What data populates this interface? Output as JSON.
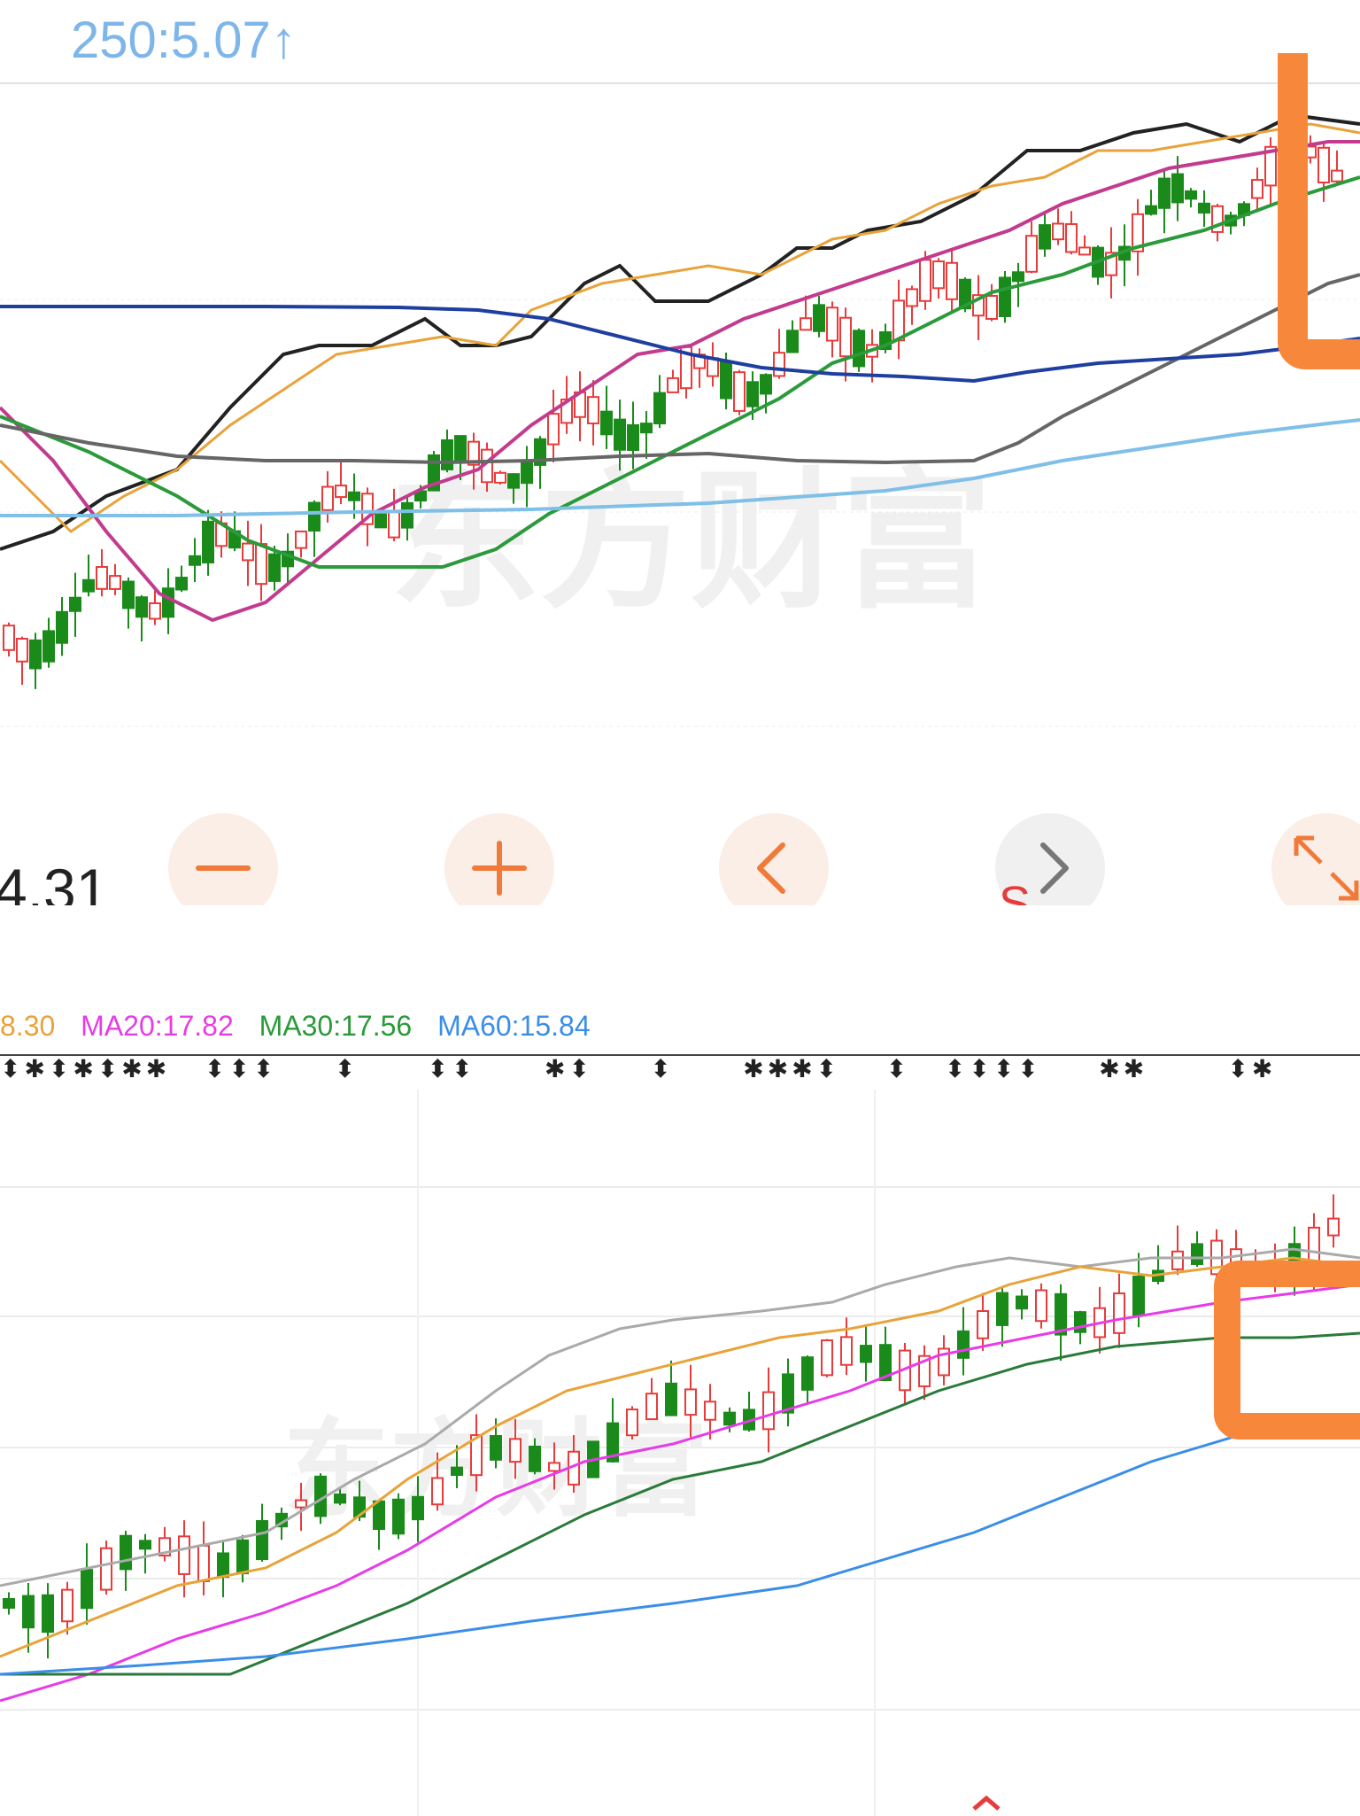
{
  "header": {
    "indicator_text": "250:5.07",
    "arrow": "up-arrow-icon"
  },
  "upper_panel": {
    "left_price": "4.31",
    "watermark": "东方财富"
  },
  "controls": [
    {
      "name": "zoom-out-button",
      "icon": "minus-icon"
    },
    {
      "name": "zoom-in-button",
      "icon": "plus-icon"
    },
    {
      "name": "prev-button",
      "icon": "chevron-left-icon"
    },
    {
      "name": "next-button",
      "icon": "chevron-right-icon"
    },
    {
      "name": "fullscreen-button",
      "icon": "expand-icon"
    }
  ],
  "lower_panel": {
    "ma_labels": [
      {
        "text": "8.30",
        "color": "#e8a33a"
      },
      {
        "text": "MA20:17.82",
        "color": "#e83be8"
      },
      {
        "text": "MA30:17.56",
        "color": "#2a9a3a"
      },
      {
        "text": "MA60:15.84",
        "color": "#3a8ee8"
      }
    ],
    "signal_marks": "⬍✱⬍✱⬍✱✱   ⬍⬍⬍     ⬍      ⬍⬍      ✱⬍     ⬍      ✱✱✱⬍    ⬍   ⬍⬍⬍⬍     ✱✱       ⬍✱",
    "watermark": "东方财富"
  },
  "chart_data": [
    {
      "type": "candlestick",
      "title": "",
      "series": [
        {
          "name": "",
          "color": "#e83b3b",
          "note_label": ""
        }
      ],
      "trend": "rising",
      "overlay_lines": [
        {
          "color": "#222222"
        },
        {
          "color": "#e8a33a"
        },
        {
          "color": "#c23b8e"
        },
        {
          "color": "#2a9a3a"
        },
        {
          "color": "#666666"
        },
        {
          "color": "#1f3fa0"
        },
        {
          "color": "#7fbfe8"
        }
      ]
    },
    {
      "type": "candlestick",
      "title": "",
      "trend": "rising",
      "overlay_lines": [
        {
          "label": "MA20",
          "value": 17.82,
          "color": "#e83be8"
        },
        {
          "label": "MA30",
          "value": 17.56,
          "color": "#2a7a3a"
        },
        {
          "label": "MA60",
          "value": 15.84,
          "color": "#3a8ee8"
        }
      ]
    }
  ]
}
